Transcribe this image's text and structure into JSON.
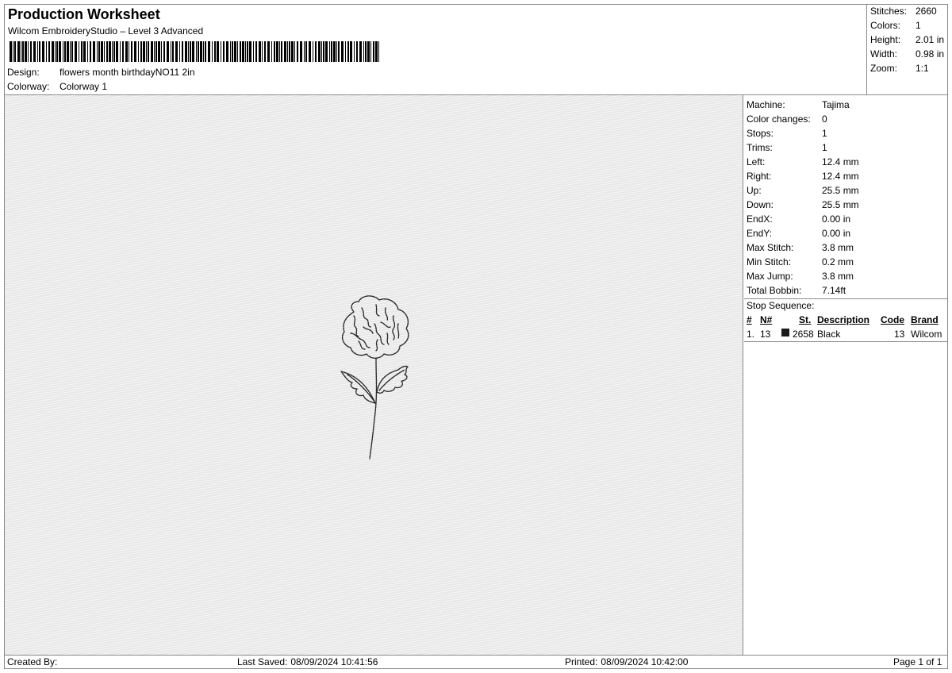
{
  "header": {
    "title": "Production Worksheet",
    "subtitle": "Wilcom EmbroideryStudio – Level 3 Advanced",
    "design_label": "Design:",
    "design_value": "flowers month birthdayNO11  2in",
    "colorway_label": "Colorway:",
    "colorway_value": "Colorway 1"
  },
  "summary": {
    "stitches_label": "Stitches:",
    "stitches": "2660",
    "colors_label": "Colors:",
    "colors": "1",
    "height_label": "Height:",
    "height": "2.01 in",
    "width_label": "Width:",
    "width": "0.98 in",
    "zoom_label": "Zoom:",
    "zoom": "1:1"
  },
  "machine": {
    "rows": [
      {
        "k": "Machine:",
        "v": "Tajima"
      },
      {
        "k": "Color changes:",
        "v": "0"
      },
      {
        "k": "Stops:",
        "v": "1"
      },
      {
        "k": "Trims:",
        "v": "1"
      },
      {
        "k": "Left:",
        "v": "12.4 mm"
      },
      {
        "k": "Right:",
        "v": "12.4 mm"
      },
      {
        "k": "Up:",
        "v": "25.5 mm"
      },
      {
        "k": "Down:",
        "v": "25.5 mm"
      },
      {
        "k": "EndX:",
        "v": "0.00 in"
      },
      {
        "k": "EndY:",
        "v": "0.00 in"
      },
      {
        "k": "Max Stitch:",
        "v": "3.8 mm"
      },
      {
        "k": "Min Stitch:",
        "v": "0.2 mm"
      },
      {
        "k": "Max Jump:",
        "v": "3.8 mm"
      },
      {
        "k": "Total Bobbin:",
        "v": "7.14ft"
      }
    ]
  },
  "stop_sequence": {
    "label": "Stop Sequence:",
    "headers": {
      "num": "#",
      "needle": "N#",
      "stitches": "St.",
      "description": "Description",
      "code": "Code",
      "brand": "Brand"
    },
    "rows": [
      {
        "num": "1.",
        "needle": "13",
        "color": "#1a1a1a",
        "stitches": "2658",
        "description": "Black",
        "code": "13",
        "brand": "Wilcom"
      }
    ]
  },
  "footer": {
    "created_by_label": "Created By:",
    "last_saved_label": "Last Saved:",
    "last_saved": "08/09/2024 10:41:56",
    "printed_label": "Printed:",
    "printed": "08/09/2024 10:42:00",
    "page": "Page 1 of 1"
  }
}
